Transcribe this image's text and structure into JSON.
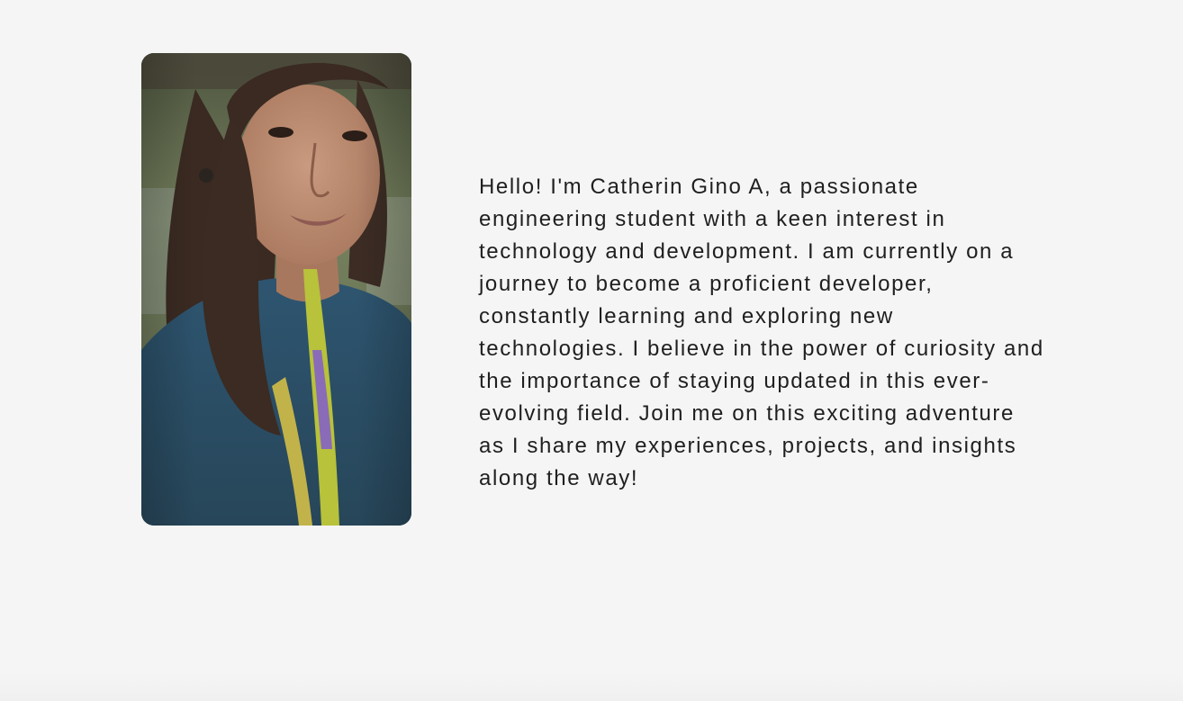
{
  "about": {
    "bio": "Hello! I'm Catherin Gino A, a passionate\nengineering student with a keen interest in\ntechnology and development. I am currently on a\njourney to become a proficient developer,\nconstantly learning and exploring new\ntechnologies. I believe in the power of curiosity and\nthe importance of staying updated in this ever-\nevolving field. Join me on this exciting adventure\nas I share my experiences, projects, and insights\nalong the way!",
    "photo": {
      "subject": "portrait-photo",
      "colors": {
        "background_green": "#6e7d56",
        "top_shade": "#5c5a4a",
        "hair": "#3a2a22",
        "skin": "#b98a70",
        "shirt": "#2c4e66",
        "lanyard_yellow": "#b8c23a",
        "lanyard_purple": "#8a6bb8"
      }
    }
  },
  "colors": {
    "page_background": "#f5f5f5",
    "text": "#1f1f1f"
  }
}
